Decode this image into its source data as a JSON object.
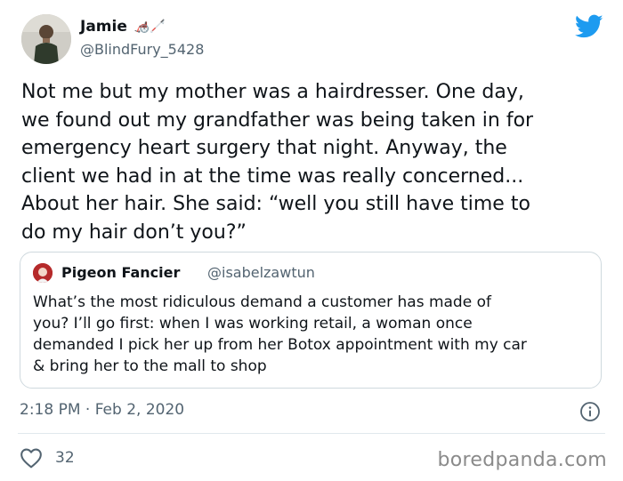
{
  "author": {
    "name": "Jamie",
    "emoji": "🦽🦯",
    "handle": "@BlindFury_5428"
  },
  "tweet": {
    "text": "Not me but my mother was a hairdresser. One day,\nwe found out my grandfather was being taken in for\nemergency heart surgery that night. Anyway, the\nclient we had in at the time was really concerned...\nAbout her hair. She said: “well you still have time to\ndo my hair don’t you?”"
  },
  "quoted_tweet": {
    "name": "Pigeon Fancier",
    "handle": "@isabelzawtun",
    "text": "What’s the most ridiculous demand a customer has made of\nyou? I’ll go first: when I was working retail, a woman once\ndemanded I pick her up from her Botox appointment with my car\n& bring her to the mall to shop"
  },
  "meta": {
    "timestamp": "2:18 PM · Feb 2, 2020",
    "like_count": "32"
  },
  "watermark": "boredpanda.com",
  "icons": {
    "logo": "twitter-bird-icon",
    "info": "info-icon",
    "like": "heart-icon"
  },
  "colors": {
    "brand": "#1d9bf0",
    "secondary_text": "#536471",
    "border": "#cfd9de"
  }
}
